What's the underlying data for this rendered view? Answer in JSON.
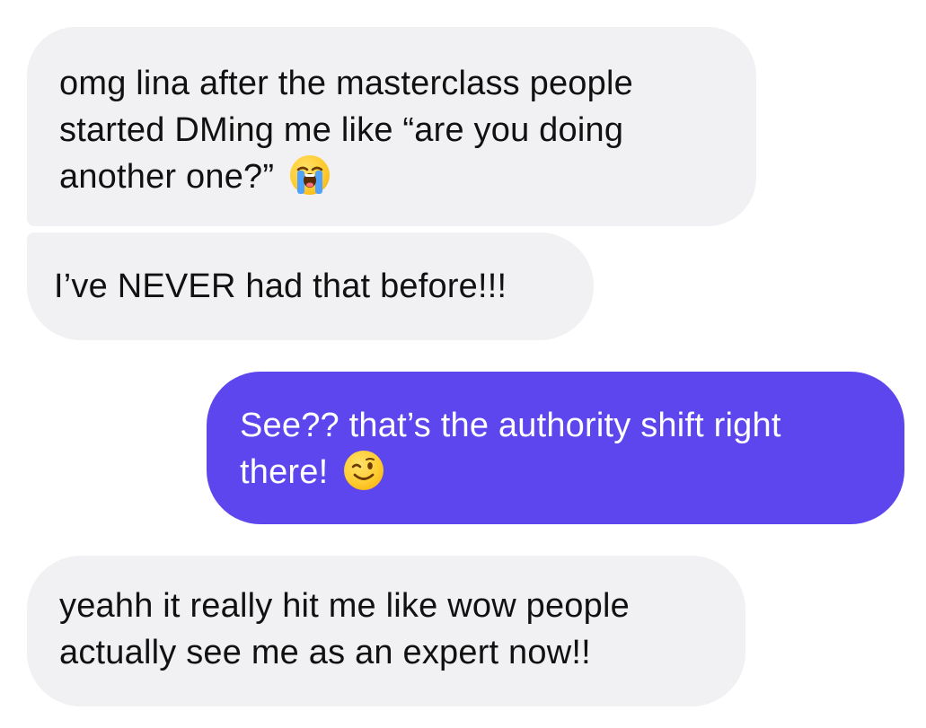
{
  "messages": [
    {
      "direction": "incoming",
      "lines": [
        "omg lina after the masterclass people",
        "started DMing me like “are you doing",
        "another one?”"
      ],
      "emoji": "loudly-crying-face-icon"
    },
    {
      "direction": "incoming",
      "lines": [
        "I’ve NEVER had that before!!!"
      ]
    },
    {
      "direction": "outgoing",
      "lines": [
        "See?? that’s the authority shift right",
        "there!"
      ],
      "emoji": "winking-face-icon"
    },
    {
      "direction": "incoming",
      "lines": [
        "yeahh it really hit me like wow people",
        "actually see me as an expert now!!"
      ]
    }
  ],
  "colors": {
    "incoming_bubble": "#f1f1f3",
    "incoming_text": "#111111",
    "outgoing_bubble": "#5e46ee",
    "outgoing_text": "#ffffff"
  }
}
